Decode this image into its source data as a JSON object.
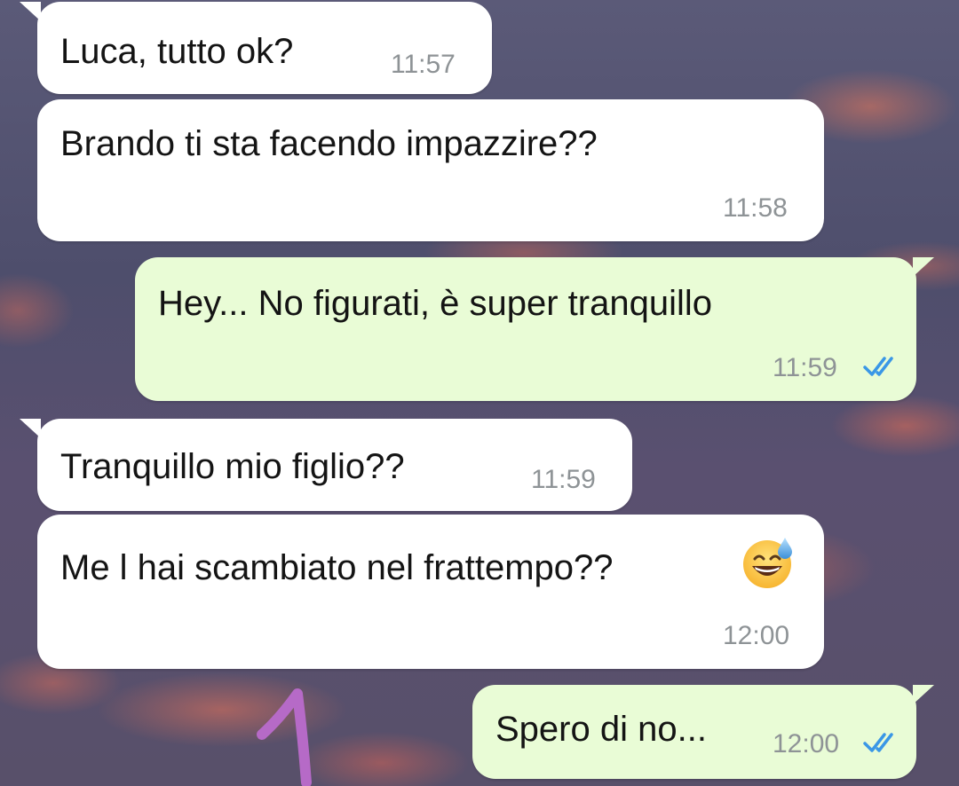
{
  "chat": {
    "messages": [
      {
        "direction": "incoming",
        "text": "Luca, tutto ok?",
        "time": "11:57"
      },
      {
        "direction": "incoming",
        "text": "Brando ti sta facendo impazzire??",
        "time": "11:58"
      },
      {
        "direction": "outgoing",
        "text": "Hey... No figurati, è super tranquillo",
        "time": "11:59",
        "status": "read"
      },
      {
        "direction": "incoming",
        "text": "Tranquillo mio figlio??",
        "time": "11:59"
      },
      {
        "direction": "incoming",
        "text": "Me l hai scambiato nel frattempo??",
        "time": "12:00",
        "emoji": "grinning-face-with-sweat"
      },
      {
        "direction": "outgoing",
        "text": "Spero di no...",
        "time": "12:00",
        "status": "read"
      }
    ]
  },
  "colors": {
    "incoming_bubble": "#ffffff",
    "outgoing_bubble": "#e9fcd6",
    "read_ticks": "#3a97e6",
    "timestamp": "#8e9396",
    "doodle": "#b66ac7"
  },
  "icons": {
    "read_status": "double-check-icon",
    "doodle": "hand-drawn-mark"
  }
}
